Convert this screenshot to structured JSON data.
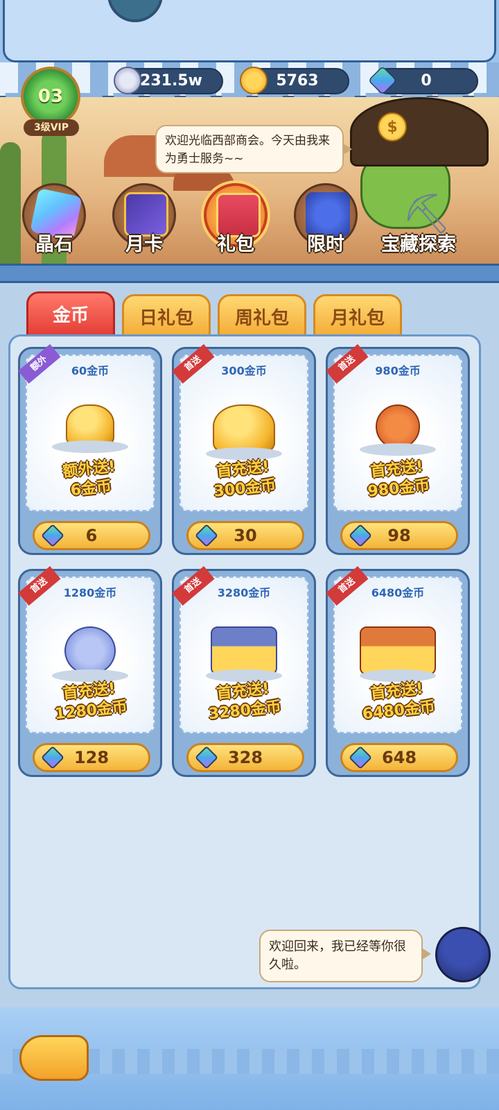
{
  "vip": {
    "level": "03",
    "label": "3级VIP"
  },
  "currencies": {
    "silver": "231.5w",
    "gold": "5763",
    "gem": "0"
  },
  "merchant_greeting": "欢迎光临西部商会。今天由我来为勇士服务~~",
  "nav": [
    {
      "label": "晶石",
      "icon": "crystal-icon"
    },
    {
      "label": "月卡",
      "icon": "card-icon"
    },
    {
      "label": "礼包",
      "icon": "gift-icon"
    },
    {
      "label": "限时",
      "icon": "bag-icon"
    },
    {
      "label": "宝藏探索",
      "icon": "pickaxe-icon"
    }
  ],
  "tabs": [
    "金币",
    "日礼包",
    "周礼包",
    "月礼包"
  ],
  "cards": [
    {
      "title": "60金币",
      "ribbon": "额外",
      "bonus_line1": "额外送!",
      "bonus_line2": "6金币",
      "price": "6"
    },
    {
      "title": "300金币",
      "ribbon": "首送",
      "bonus_line1": "首充送!",
      "bonus_line2": "300金币",
      "price": "30"
    },
    {
      "title": "980金币",
      "ribbon": "首送",
      "bonus_line1": "首充送!",
      "bonus_line2": "980金币",
      "price": "98"
    },
    {
      "title": "1280金币",
      "ribbon": "首送",
      "bonus_line1": "首充送!",
      "bonus_line2": "1280金币",
      "price": "128"
    },
    {
      "title": "3280金币",
      "ribbon": "首送",
      "bonus_line1": "首充送!",
      "bonus_line2": "3280金币",
      "price": "328"
    },
    {
      "title": "6480金币",
      "ribbon": "首送",
      "bonus_line1": "首充送!",
      "bonus_line2": "6480金币",
      "price": "648"
    }
  ],
  "npc_message": "欢迎回来，我已经等你很久啦。",
  "colors": {
    "accent_red": "#e33c34",
    "tab_gold": "#f3ac36",
    "panel_blue": "#d9e7f5"
  }
}
